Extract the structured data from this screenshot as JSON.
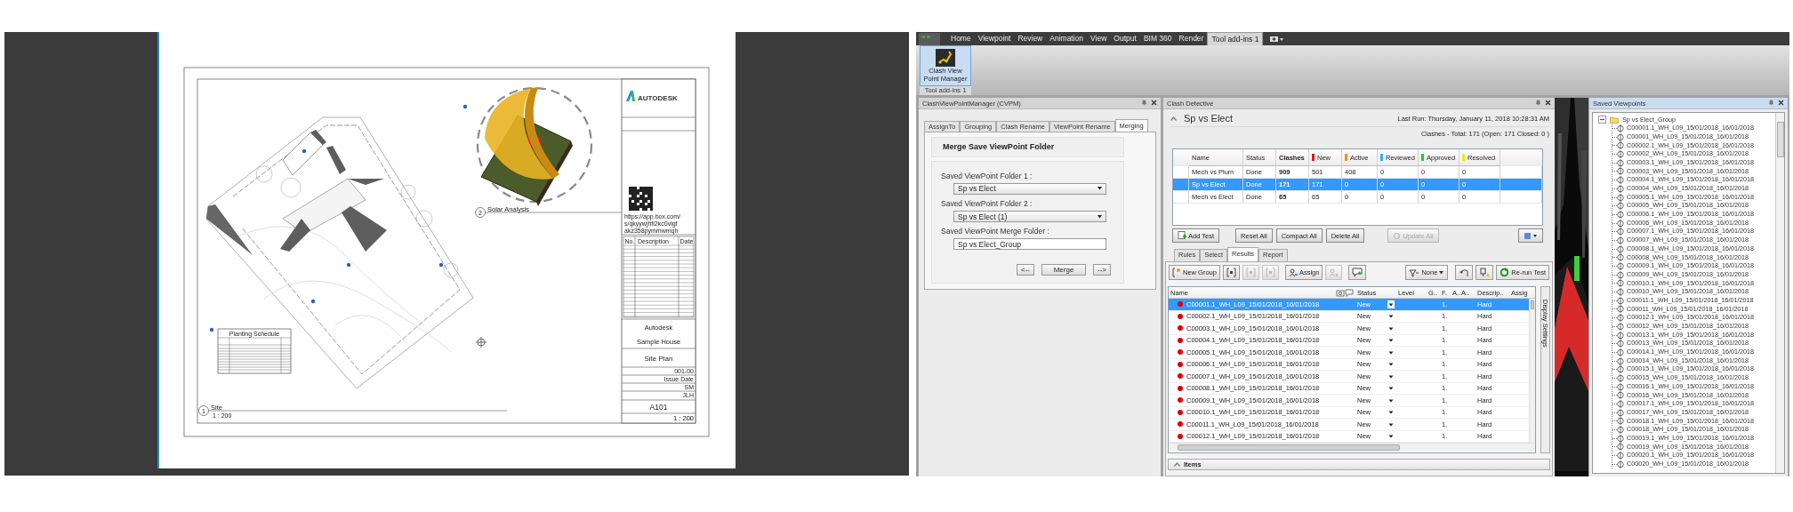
{
  "sheet": {
    "views": [
      {
        "number": "1",
        "title": "Site",
        "scale": "1 : 200"
      },
      {
        "number": "2",
        "title": "Solar Analysis"
      }
    ],
    "planting_schedule": {
      "title": "Planting Schedule"
    },
    "title_block": {
      "logo": "AUTODESK",
      "link_lines": [
        "https://app.box.com/",
        "s/qkyywjhfi2kc0vlgf",
        "akz358pymmwmqh"
      ],
      "revision_columns": [
        "No.",
        "Description",
        "Date"
      ],
      "client": "Autodesk",
      "project": "Sample House",
      "sheet_name": "Site Plan",
      "info": [
        "001-00",
        "Issue Date",
        "SM",
        "JLH"
      ],
      "sheet_number": "A101",
      "scale": "1 : 200"
    }
  },
  "ribbon": {
    "tabs": [
      {
        "label": "Home",
        "selected": false
      },
      {
        "label": "Viewpoint",
        "selected": false
      },
      {
        "label": "Review",
        "selected": false
      },
      {
        "label": "Animation",
        "selected": false
      },
      {
        "label": "View",
        "selected": false
      },
      {
        "label": "Output",
        "selected": false
      },
      {
        "label": "BIM 360",
        "selected": false
      },
      {
        "label": "Render",
        "selected": false
      },
      {
        "label": "Tool add-ins 1",
        "selected": true
      }
    ],
    "buttons": [
      {
        "label": "Clash View Point Manager",
        "selected": true
      }
    ],
    "panel_label": "Tool add-ins 1"
  },
  "cvpm_panel": {
    "title": "ClashViewPointManager (CVPM)",
    "tabs": [
      {
        "label": "AssignTo",
        "selected": false
      },
      {
        "label": "Grouping",
        "selected": false
      },
      {
        "label": "Clash Rename",
        "selected": false
      },
      {
        "label": "ViewPoint Rename",
        "selected": false
      },
      {
        "label": "Merging",
        "selected": true
      }
    ],
    "section_title": "Merge Save ViewPoint Folder",
    "fields": [
      {
        "label": "Saved ViewPoint Folder 1 :",
        "value": "Sp vs Elect",
        "kind": "dropdown"
      },
      {
        "label": "Saved ViewPoint Folder 2 :",
        "value": "Sp vs Elect (1)",
        "kind": "dropdown"
      },
      {
        "label": "Saved ViewPoint Merge Folder :",
        "value": "Sp vs Elect_Group",
        "kind": "text"
      }
    ],
    "buttons": [
      "<--",
      "Merge",
      "-->"
    ]
  },
  "clash_detective": {
    "title": "Clash Detective",
    "test_name": "Sp vs Elect",
    "last_run": "Last Run:  Thursday, January 11, 2018 10:28:31 AM",
    "summary": "Clashes -  Total:  171  (Open:  171  Closed:  0 )",
    "tests": {
      "columns": [
        {
          "label": "Name"
        },
        {
          "label": "Status"
        },
        {
          "label": "Clashes"
        },
        {
          "label": "New",
          "color": "#e8141c"
        },
        {
          "label": "Active",
          "color": "#f28c1c"
        },
        {
          "label": "Reviewed",
          "color": "#28b4f0"
        },
        {
          "label": "Approved",
          "color": "#1ed21e"
        },
        {
          "label": "Resolved",
          "color": "#f0e614"
        }
      ],
      "rows": [
        {
          "cells": [
            "Mech vs Plum",
            "Done",
            "909",
            "501",
            "408",
            "0",
            "0",
            "0"
          ],
          "selected": false
        },
        {
          "cells": [
            "Sp vs Elect",
            "Done",
            "171",
            "171",
            "0",
            "0",
            "0",
            "0"
          ],
          "selected": true
        },
        {
          "cells": [
            "Mech vs Elect",
            "Done",
            "65",
            "65",
            "0",
            "0",
            "0",
            "0"
          ],
          "selected": false
        }
      ]
    },
    "test_buttons": [
      {
        "label": "Add Test",
        "kind": "add",
        "disabled": false
      },
      {
        "label": "Reset All",
        "kind": "plain",
        "disabled": false
      },
      {
        "label": "Compact All",
        "kind": "plain",
        "disabled": false
      },
      {
        "label": "Delete All",
        "kind": "plain",
        "disabled": false
      },
      {
        "label": "Update All",
        "kind": "update",
        "disabled": true
      }
    ],
    "tabs": [
      {
        "label": "Rules",
        "selected": false
      },
      {
        "label": "Select",
        "selected": false
      },
      {
        "label": "Results",
        "selected": true
      },
      {
        "label": "Report",
        "selected": false
      }
    ],
    "toolbar_left": [
      {
        "kind": "new_group",
        "label": "New Group",
        "disabled": false
      },
      {
        "kind": "group",
        "disabled": false
      },
      {
        "kind": "group",
        "disabled": true
      },
      {
        "kind": "group",
        "disabled": true
      },
      {
        "kind": "assign",
        "label": "Assign",
        "disabled": false
      },
      {
        "kind": "unassign",
        "disabled": true
      },
      {
        "kind": "comment",
        "disabled": false
      }
    ],
    "toolbar_right": [
      {
        "kind": "filter",
        "label": "None",
        "disabled": false
      },
      {
        "kind": "reset",
        "disabled": false
      },
      {
        "kind": "pin",
        "disabled": false
      },
      {
        "kind": "rerun",
        "label": "Re-run Test",
        "disabled": false
      }
    ],
    "results": {
      "columns": [
        "Name",
        "Status",
        "Level",
        "G..",
        "F.",
        "A..",
        "A..",
        "Descrip..",
        "Assig"
      ],
      "rows": [
        {
          "name": "C00001.1_WH_L09_15/01/2018_16/01/2018",
          "status": "New",
          "f": "1.",
          "description": "Hard",
          "color": "#e00000",
          "selected": true
        },
        {
          "name": "C00002.1_WH_L09_15/01/2018_16/01/2018",
          "status": "New",
          "f": "1.",
          "description": "Hard",
          "color": "#e00000",
          "selected": false
        },
        {
          "name": "C00003.1_WH_L09_15/01/2018_16/01/2018",
          "status": "New",
          "f": "1.",
          "description": "Hard",
          "color": "#e00000",
          "selected": false
        },
        {
          "name": "C00004.1_WH_L09_15/01/2018_16/01/2018",
          "status": "New",
          "f": "1.",
          "description": "Hard",
          "color": "#e00000",
          "selected": false
        },
        {
          "name": "C00005.1_WH_L09_15/01/2018_16/01/2018",
          "status": "New",
          "f": "1.",
          "description": "Hard",
          "color": "#e00000",
          "selected": false
        },
        {
          "name": "C00006.1_WH_L09_15/01/2018_16/01/2018",
          "status": "New",
          "f": "1.",
          "description": "Hard",
          "color": "#e00000",
          "selected": false
        },
        {
          "name": "C00007.1_WH_L09_15/01/2018_16/01/2018",
          "status": "New",
          "f": "1.",
          "description": "Hard",
          "color": "#e00000",
          "selected": false
        },
        {
          "name": "C00008.1_WH_L09_15/01/2018_16/01/2018",
          "status": "New",
          "f": "1.",
          "description": "Hard",
          "color": "#e00000",
          "selected": false
        },
        {
          "name": "C00009.1_WH_L09_15/01/2018_16/01/2018",
          "status": "New",
          "f": "1.",
          "description": "Hard",
          "color": "#e00000",
          "selected": false
        },
        {
          "name": "C00010.1_WH_L09_15/01/2018_16/01/2018",
          "status": "New",
          "f": "1.",
          "description": "Hard",
          "color": "#e00000",
          "selected": false
        },
        {
          "name": "C00011.1_WH_L09_15/01/2018_16/01/2018",
          "status": "New",
          "f": "1.",
          "description": "Hard",
          "color": "#e00000",
          "selected": false
        },
        {
          "name": "C00012.1_WH_L09_15/01/2018_16/01/2018",
          "status": "New",
          "f": "1.",
          "description": "Hard",
          "color": "#e00000",
          "selected": false
        }
      ]
    },
    "side_tab": "Display Settings",
    "items_label": "Items"
  },
  "saved_viewpoints": {
    "title": "Saved Viewpoints",
    "root": {
      "label": "Sp vs Elect_Group",
      "expanded": true,
      "children": [
        {
          "label": "C00001.1_WH_L09_15/01/2018_16/01/2018"
        },
        {
          "label": "C00001_WH_L09_15/01/2018_16/01/2018"
        },
        {
          "label": "C00002.1_WH_L09_15/01/2018_16/01/2018"
        },
        {
          "label": "C00002_WH_L09_15/01/2018_16/01/2018"
        },
        {
          "label": "C00003.1_WH_L09_15/01/2018_16/01/2018"
        },
        {
          "label": "C00003_WH_L09_15/01/2018_16/01/2018"
        },
        {
          "label": "C00004.1_WH_L09_15/01/2018_16/01/2018"
        },
        {
          "label": "C00004_WH_L09_15/01/2018_16/01/2018"
        },
        {
          "label": "C00005.1_WH_L09_15/01/2018_16/01/2018"
        },
        {
          "label": "C00005_WH_L09_15/01/2018_16/01/2018"
        },
        {
          "label": "C00006.1_WH_L09_15/01/2018_16/01/2018"
        },
        {
          "label": "C00006_WH_L09_15/01/2018_16/01/2018"
        },
        {
          "label": "C00007.1_WH_L09_15/01/2018_16/01/2018"
        },
        {
          "label": "C00007_WH_L09_15/01/2018_16/01/2018"
        },
        {
          "label": "C00008.1_WH_L09_15/01/2018_16/01/2018"
        },
        {
          "label": "C00008_WH_L09_15/01/2018_16/01/2018"
        },
        {
          "label": "C00009.1_WH_L09_15/01/2018_16/01/2018"
        },
        {
          "label": "C00009_WH_L09_15/01/2018_16/01/2018"
        },
        {
          "label": "C00010.1_WH_L09_15/01/2018_16/01/2018"
        },
        {
          "label": "C00010_WH_L09_15/01/2018_16/01/2018"
        },
        {
          "label": "C00011.1_WH_L09_15/01/2018_16/01/2018"
        },
        {
          "label": "C00011_WH_L09_15/01/2018_16/01/2018"
        },
        {
          "label": "C00012.1_WH_L09_15/01/2018_16/01/2018"
        },
        {
          "label": "C00012_WH_L09_15/01/2018_16/01/2018"
        },
        {
          "label": "C00013.1_WH_L09_15/01/2018_16/01/2018"
        },
        {
          "label": "C00013_WH_L09_15/01/2018_16/01/2018"
        },
        {
          "label": "C00014.1_WH_L09_15/01/2018_16/01/2018"
        },
        {
          "label": "C00014_WH_L09_15/01/2018_16/01/2018"
        },
        {
          "label": "C00015.1_WH_L09_15/01/2018_16/01/2018"
        },
        {
          "label": "C00015_WH_L09_15/01/2018_16/01/2018"
        },
        {
          "label": "C00016.1_WH_L09_15/01/2018_16/01/2018"
        },
        {
          "label": "C00016_WH_L09_15/01/2018_16/01/2018"
        },
        {
          "label": "C00017.1_WH_L09_15/01/2018_16/01/2018"
        },
        {
          "label": "C00017_WH_L09_15/01/2018_16/01/2018"
        },
        {
          "label": "C00018.1_WH_L09_15/01/2018_16/01/2018"
        },
        {
          "label": "C00018_WH_L09_15/01/2018_16/01/2018"
        },
        {
          "label": "C00019.1_WH_L09_15/01/2018_16/01/2018"
        },
        {
          "label": "C00019_WH_L09_15/01/2018_16/01/2018"
        },
        {
          "label": "C00020.1_WH_L09_15/01/2018_16/01/2018"
        },
        {
          "label": "C00020_WH_L09_15/01/2018_16/01/2018"
        }
      ]
    }
  }
}
